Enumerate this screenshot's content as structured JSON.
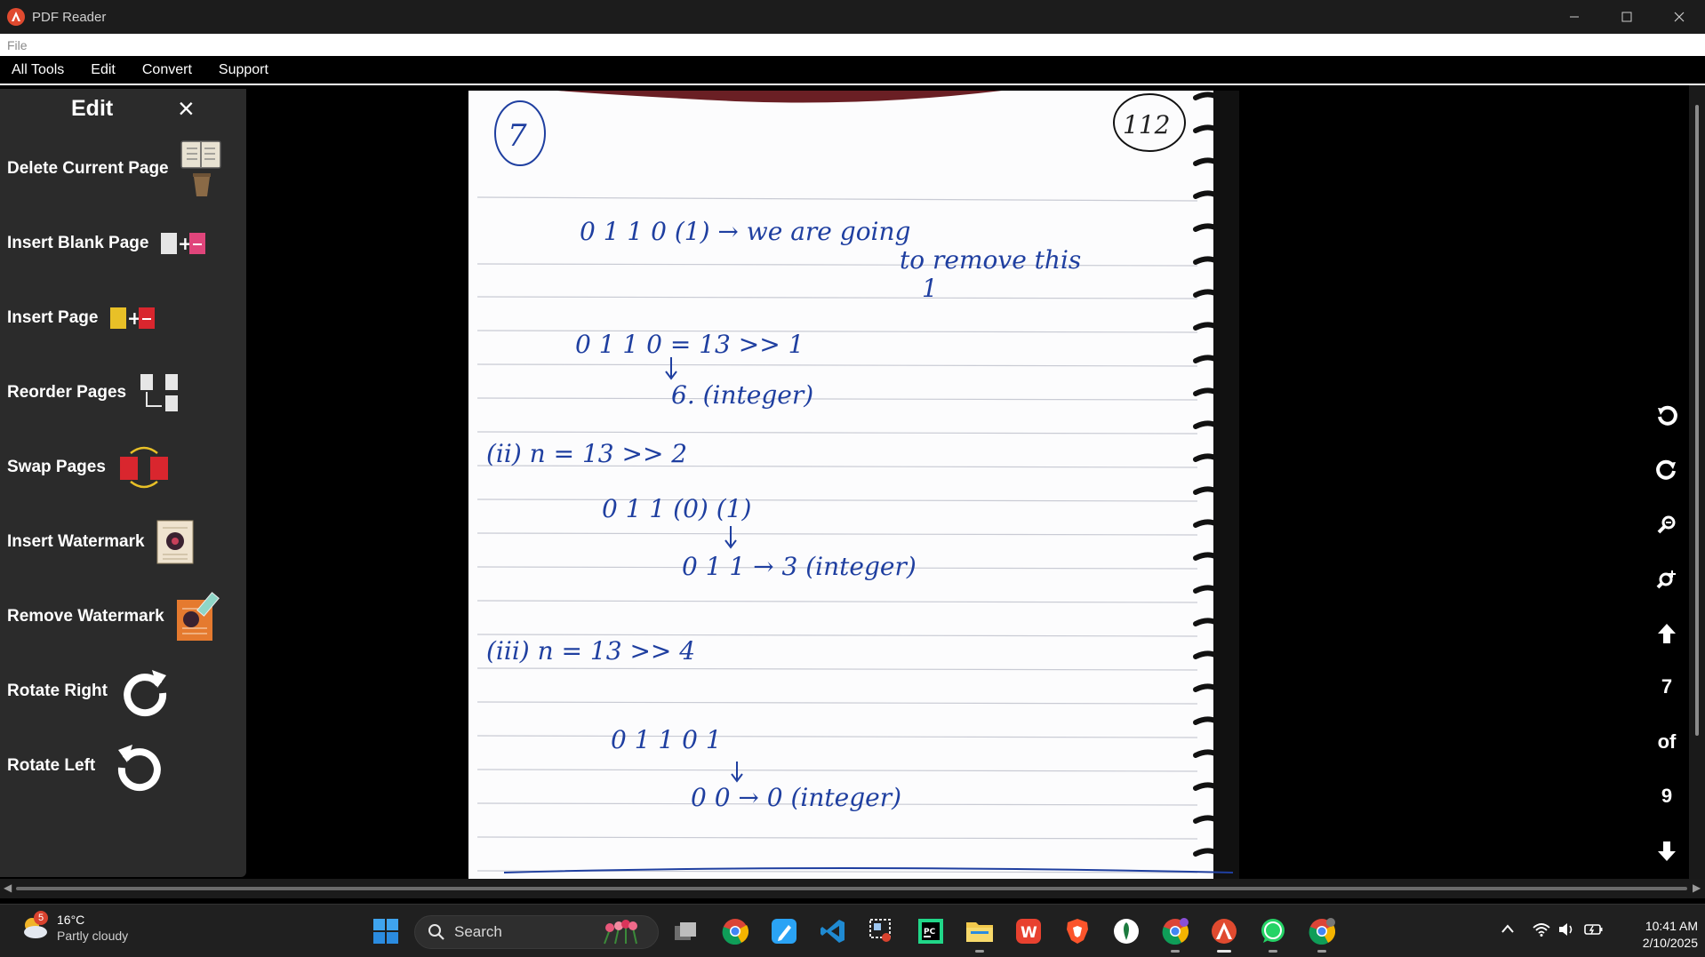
{
  "window": {
    "title": "PDF Reader"
  },
  "menubar_top": {
    "file": "File"
  },
  "menubar_main": {
    "all_tools": "All Tools",
    "edit": "Edit",
    "convert": "Convert",
    "support": "Support"
  },
  "sidebar": {
    "title": "Edit",
    "close": "×",
    "items": [
      {
        "label": "Delete Current Page",
        "icon": "delete-page-icon"
      },
      {
        "label": "Insert Blank Page",
        "icon": "insert-blank-page-icon"
      },
      {
        "label": "Insert Page",
        "icon": "insert-page-icon"
      },
      {
        "label": "Reorder Pages",
        "icon": "reorder-pages-icon"
      },
      {
        "label": "Swap Pages",
        "icon": "swap-pages-icon"
      },
      {
        "label": "Insert Watermark",
        "icon": "insert-watermark-icon"
      },
      {
        "label": "Remove Watermark",
        "icon": "remove-watermark-icon"
      },
      {
        "label": "Rotate Right",
        "icon": "rotate-right-icon"
      },
      {
        "label": "Rotate Left",
        "icon": "rotate-left-icon"
      }
    ]
  },
  "page_content": {
    "page_no_left": "7",
    "page_no_right": "112",
    "lines": [
      "0 1 1 0 (1) → we are going",
      "to remove this",
      "1",
      "0 1 1 0 = 13 >> 1",
      "6. (integer)",
      "(ii) n = 13 >> 2",
      "0 1 1 (0) (1)",
      "0 1 1 → 3 (integer)",
      "(iii) n = 13 >> 4",
      "0 1 1 0 1",
      "0 0 → 0 (integer)"
    ]
  },
  "navigation": {
    "current_page": "7",
    "of_label": "of",
    "total_pages": "9"
  },
  "taskbar": {
    "weather_temp": "16°C",
    "weather_condition": "Partly cloudy",
    "weather_badge": "5",
    "search_label": "Search",
    "time": "10:41 AM",
    "date": "2/10/2025"
  },
  "colors": {
    "sidebar_bg": "#2b2b2b",
    "titlebar_bg": "#1c1c1c",
    "ink": "#1f3fa0",
    "taskbar_bg": "#202020"
  }
}
